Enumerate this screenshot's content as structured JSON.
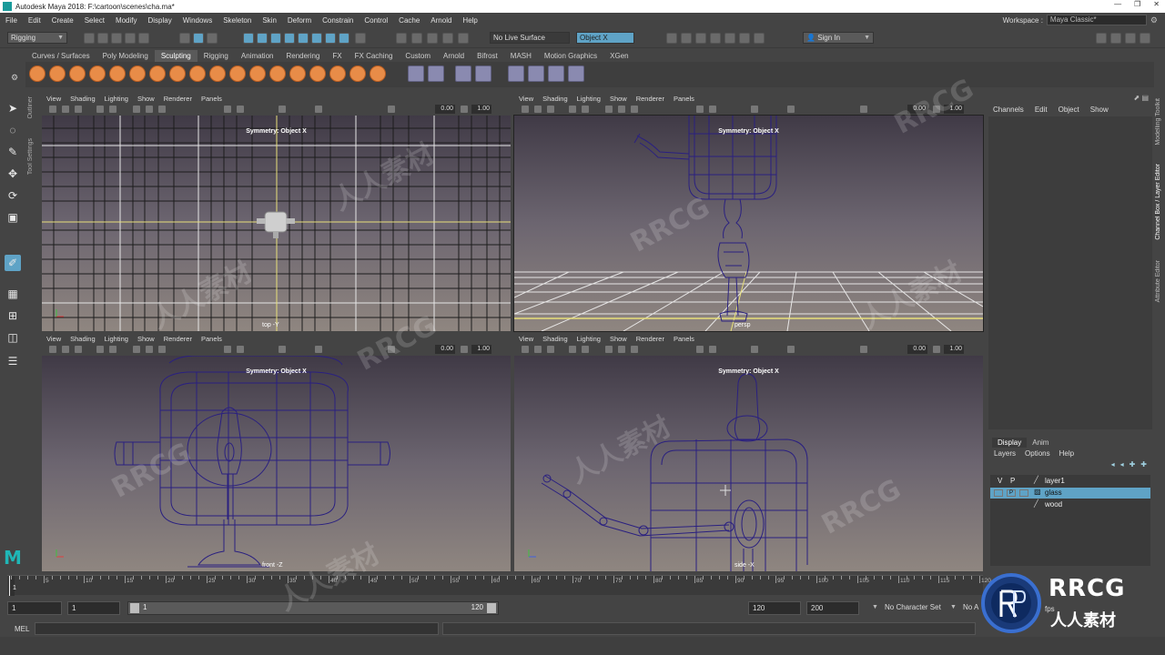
{
  "window": {
    "title": "Autodesk Maya 2018: F:\\cartoon\\scenes\\cha.ma*",
    "controls": [
      "—",
      "❐",
      "✕"
    ]
  },
  "menubar": {
    "items": [
      "File",
      "Edit",
      "Create",
      "Select",
      "Modify",
      "Display",
      "Windows",
      "Skeleton",
      "Skin",
      "Deform",
      "Constrain",
      "Control",
      "Cache",
      "Arnold",
      "Help"
    ],
    "workspace_label": "Workspace :",
    "workspace_value": "Maya Classic*"
  },
  "statusline": {
    "mode": "Rigging",
    "live_surface": "No Live Surface",
    "symmetry": "Object X",
    "sign_in": "Sign In"
  },
  "shelf": {
    "tabs": [
      "Curves / Surfaces",
      "Poly Modeling",
      "Sculpting",
      "Rigging",
      "Animation",
      "Rendering",
      "FX",
      "FX Caching",
      "Custom",
      "Arnold",
      "Bifrost",
      "MASH",
      "Motion Graphics",
      "XGen"
    ],
    "active_tab": "Sculpting"
  },
  "side_tabs": [
    "Outliner",
    "Tool Settings"
  ],
  "viewports": [
    {
      "menu": [
        "View",
        "Shading",
        "Lighting",
        "Show",
        "Renderer",
        "Panels"
      ],
      "symmetry": "Symmetry: Object X",
      "camera": "top -Y",
      "field1": "0.00",
      "field2": "1.00"
    },
    {
      "menu": [
        "View",
        "Shading",
        "Lighting",
        "Show",
        "Renderer",
        "Panels"
      ],
      "symmetry": "Symmetry: Object X",
      "camera": "persp",
      "field1": "0.00",
      "field2": "1.00"
    },
    {
      "menu": [
        "View",
        "Shading",
        "Lighting",
        "Show",
        "Renderer",
        "Panels"
      ],
      "symmetry": "Symmetry: Object X",
      "camera": "front -Z",
      "field1": "0.00",
      "field2": "1.00"
    },
    {
      "menu": [
        "View",
        "Shading",
        "Lighting",
        "Show",
        "Renderer",
        "Panels"
      ],
      "symmetry": "Symmetry: Object X",
      "camera": "side -X",
      "field1": "0.00",
      "field2": "1.00"
    }
  ],
  "channel_box": {
    "menu": [
      "Channels",
      "Edit",
      "Object",
      "Show"
    ]
  },
  "right_tabs": [
    "Modelling Toolkit",
    "Channel Box / Layer Editor",
    "Attribute Editor"
  ],
  "layer_editor": {
    "tabs": [
      "Display",
      "Anim"
    ],
    "menu": [
      "Layers",
      "Options",
      "Help"
    ],
    "header_v": "V",
    "header_p": "P",
    "layers": [
      {
        "name": "layer1",
        "selected": false
      },
      {
        "name": "glass",
        "selected": true,
        "p_label": "P"
      },
      {
        "name": "wood",
        "selected": false
      }
    ]
  },
  "timeline": {
    "ticks": [
      "1",
      "5",
      "10",
      "15",
      "20",
      "25",
      "30",
      "35",
      "40",
      "45",
      "50",
      "55",
      "60",
      "65",
      "70",
      "75",
      "80",
      "85",
      "90",
      "95",
      "100",
      "105",
      "110",
      "115",
      "120"
    ],
    "current_frame": "1"
  },
  "range": {
    "start": "1",
    "playback_start": "1",
    "slider_start": "1",
    "slider_end": "120",
    "playback_end": "120",
    "end": "200",
    "character_set": "No Character Set",
    "anim_layer": "No A",
    "fps": "fps"
  },
  "command_line": {
    "label": "MEL"
  },
  "watermarks": [
    "人人素材",
    "RRCG",
    "RRCG",
    "人人素材",
    "RRCG",
    "人人素材",
    "RRCG",
    "人人素材",
    "RRCG",
    "人人素材"
  ],
  "brand": {
    "logo": "RRCG",
    "sub": "人人素材"
  }
}
